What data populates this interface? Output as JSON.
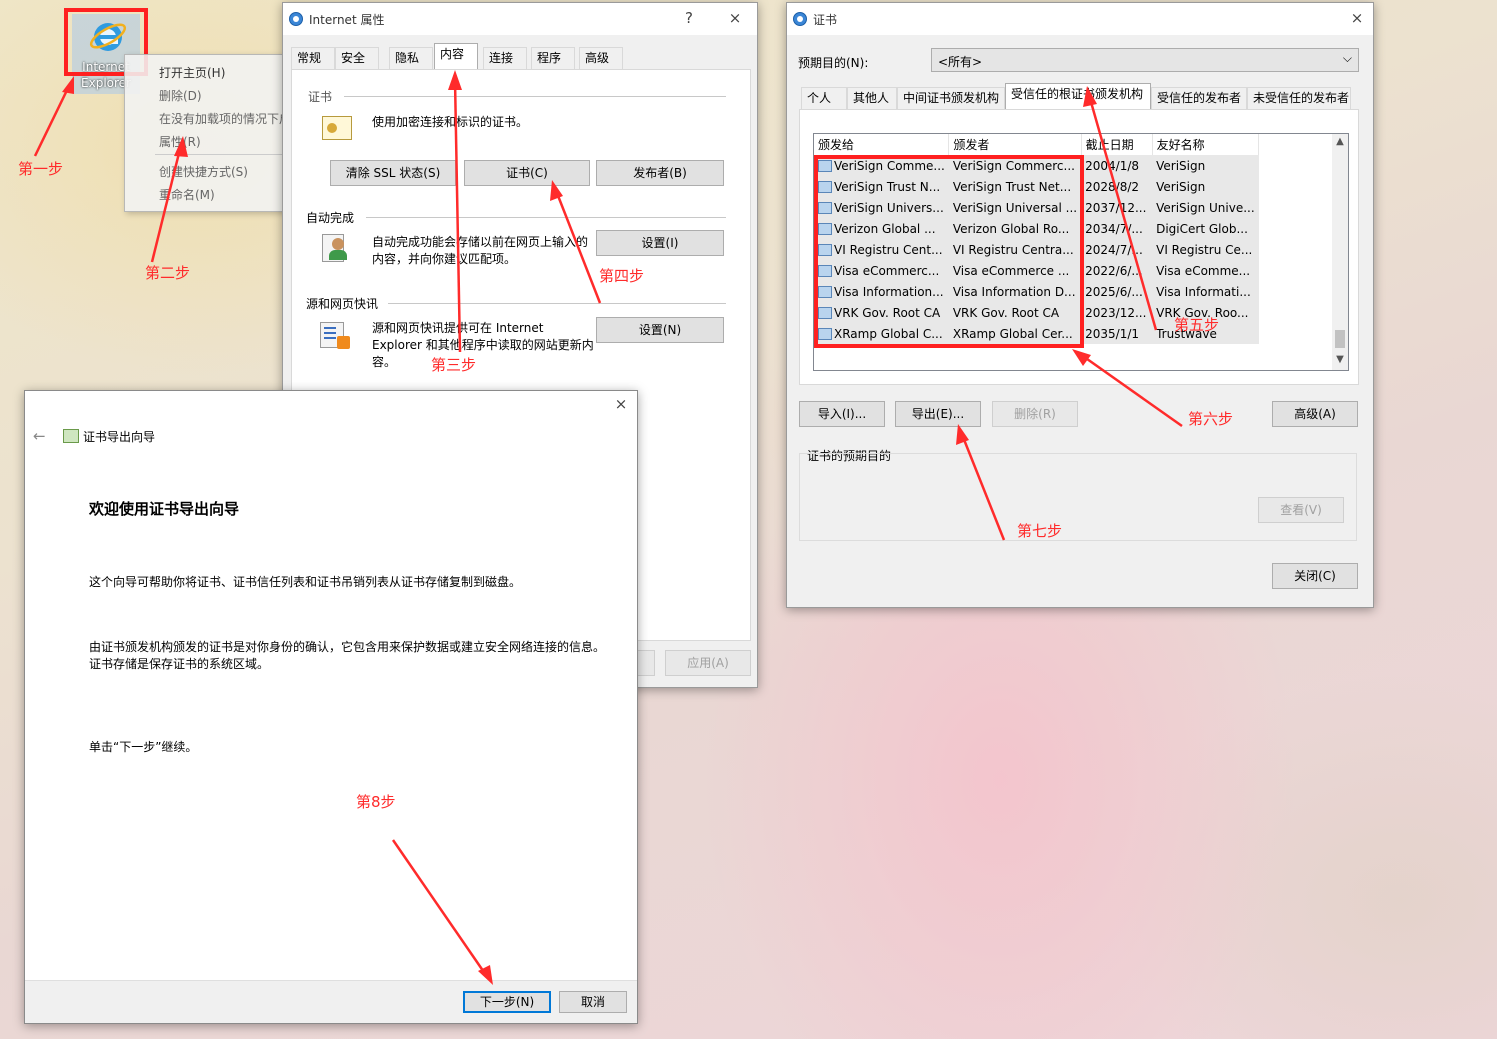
{
  "desktop": {
    "icon_label_line1": "Internet",
    "icon_label_line2": "Explorer"
  },
  "context_menu": {
    "items": [
      "打开主页(H)",
      "删除(D)",
      "在没有加载项的情况下启动",
      "属性(R)",
      "创建快捷方式(S)",
      "重命名(M)"
    ]
  },
  "annotations": {
    "step1": "第一步",
    "step2": "第二步",
    "step3": "第三步",
    "step4": "第四步",
    "step5": "第五步",
    "step6": "第六步",
    "step7": "第七步",
    "step8": "第8步",
    "color": "#ff2b2b"
  },
  "inet_props": {
    "title": "Internet 属性",
    "help": "?",
    "close": "×",
    "tabs": [
      "常规",
      "安全",
      "隐私",
      "内容",
      "连接",
      "程序",
      "高级"
    ],
    "active_tab": "内容",
    "cert_group": "证书",
    "cert_desc": "使用加密连接和标识的证书。",
    "clear_ssl": "清除 SSL 状态(S)",
    "certs_btn": "证书(C)",
    "publishers_btn": "发布者(B)",
    "autocomplete_group": "自动完成",
    "autocomplete_desc": "自动完成功能会存储以前在网页上输入的内容，并向你建议匹配项。",
    "autocomplete_btn": "设置(I)",
    "feeds_group": "源和网页快讯",
    "feeds_desc": "源和网页快讯提供可在 Internet Explorer 和其他程序中读取的网站更新内容。",
    "feeds_btn": "设置(N)",
    "apply_btn": "应用(A)"
  },
  "cert_dialog": {
    "title": "证书",
    "close": "×",
    "purpose_label": "预期目的(N):",
    "purpose_value": "<所有>",
    "tabs": [
      "个人",
      "其他人",
      "中间证书颁发机构",
      "受信任的根证书颁发机构",
      "受信任的发布者",
      "未受信任的发布者"
    ],
    "active_tab": "受信任的根证书颁发机构",
    "columns": [
      "颁发给",
      "颁发者",
      "截止日期",
      "友好名称"
    ],
    "rows": [
      [
        "VeriSign Comme...",
        "VeriSign Commerc...",
        "2004/1/8",
        "VeriSign"
      ],
      [
        "VeriSign Trust N...",
        "VeriSign Trust Net...",
        "2028/8/2",
        "VeriSign"
      ],
      [
        "VeriSign Univers...",
        "VeriSign Universal ...",
        "2037/12...",
        "VeriSign Unive..."
      ],
      [
        "Verizon Global ...",
        "Verizon Global Ro...",
        "2034/7/...",
        "DigiCert Glob..."
      ],
      [
        "VI Registru Cent...",
        "VI Registru Centra...",
        "2024/7/...",
        "VI Registru Ce..."
      ],
      [
        "Visa eCommerc...",
        "Visa eCommerce ...",
        "2022/6/...",
        "Visa eComme..."
      ],
      [
        "Visa Information...",
        "Visa Information D...",
        "2025/6/...",
        "Visa Informati..."
      ],
      [
        "VRK Gov. Root CA",
        "VRK Gov. Root CA",
        "2023/12...",
        "VRK Gov. Roo..."
      ],
      [
        "XRamp Global C...",
        "XRamp Global Cer...",
        "2035/1/1",
        "Trustwave"
      ]
    ],
    "import_btn": "导入(I)...",
    "export_btn": "导出(E)...",
    "remove_btn": "删除(R)",
    "advanced_btn": "高级(A)",
    "purposes_group": "证书的预期目的",
    "view_btn": "查看(V)",
    "close_btn": "关闭(C)"
  },
  "wizard": {
    "close": "×",
    "back": "←",
    "title": "证书导出向导",
    "heading": "欢迎使用证书导出向导",
    "para1": "这个向导可帮助你将证书、证书信任列表和证书吊销列表从证书存储复制到磁盘。",
    "para2": "由证书颁发机构颁发的证书是对你身份的确认，它包含用来保护数据或建立安全网络连接的信息。证书存储是保存证书的系统区域。",
    "para3": "单击“下一步”继续。",
    "next_btn": "下一步(N)",
    "cancel_btn": "取消"
  }
}
